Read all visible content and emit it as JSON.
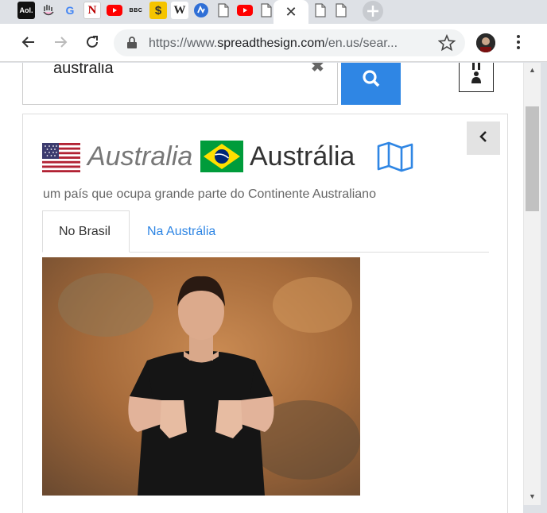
{
  "browser": {
    "tabs": [
      {
        "icon": "aol-icon",
        "label": "Aol."
      },
      {
        "icon": "hand-icon",
        "label": ""
      },
      {
        "icon": "google-icon",
        "label": "G"
      },
      {
        "icon": "n-icon",
        "label": "N"
      },
      {
        "icon": "youtube-icon",
        "label": ""
      },
      {
        "icon": "bbc-icon",
        "label": "BBC"
      },
      {
        "icon": "dollar-icon",
        "label": "$"
      },
      {
        "icon": "wikipedia-icon",
        "label": "W"
      },
      {
        "icon": "sign-icon",
        "label": ""
      },
      {
        "icon": "page-icon",
        "label": ""
      },
      {
        "icon": "youtube-icon",
        "label": ""
      },
      {
        "icon": "page-icon",
        "label": ""
      }
    ],
    "url_prefix": "https://www.",
    "url_domain": "spreadthesign.com",
    "url_rest": "/en.us/sear..."
  },
  "search": {
    "value": "australia",
    "clear": "✖"
  },
  "entry": {
    "word_en": "Australia",
    "word_pt": "Austrália",
    "description": "um país que ocupa grande parte do Continente Australiano",
    "tabs": [
      {
        "label": "No Brasil",
        "active": true
      },
      {
        "label": "Na Austrália",
        "active": false
      }
    ]
  },
  "colors": {
    "accent": "#2f86e4",
    "tab_link": "#2f86e4"
  }
}
